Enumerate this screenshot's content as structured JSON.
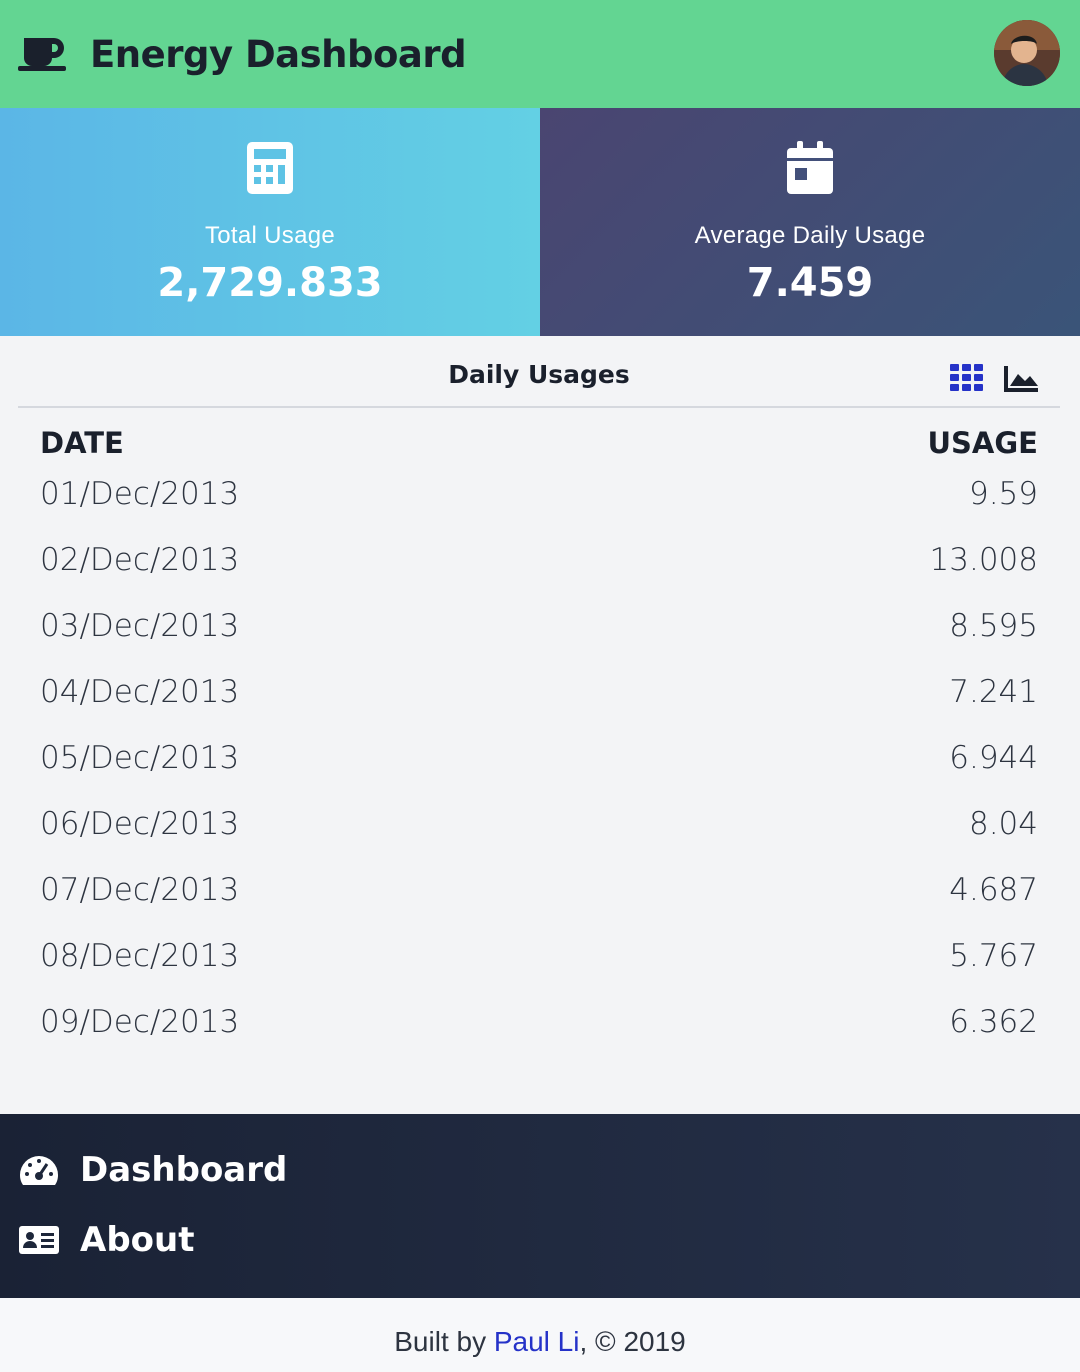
{
  "header": {
    "title": "Energy Dashboard",
    "logo_icon": "mug-icon"
  },
  "stats": {
    "total": {
      "label": "Total Usage",
      "value": "2,729.833",
      "icon": "calculator-icon"
    },
    "average": {
      "label": "Average Daily Usage",
      "value": "7.459",
      "icon": "calendar-icon"
    }
  },
  "panel": {
    "title": "Daily Usages",
    "columns": {
      "date": "DATE",
      "usage": "USAGE"
    },
    "rows": [
      {
        "date": "01/Dec/2013",
        "usage": "9.59"
      },
      {
        "date": "02/Dec/2013",
        "usage": "13.008"
      },
      {
        "date": "03/Dec/2013",
        "usage": "8.595"
      },
      {
        "date": "04/Dec/2013",
        "usage": "7.241"
      },
      {
        "date": "05/Dec/2013",
        "usage": "6.944"
      },
      {
        "date": "06/Dec/2013",
        "usage": "8.04"
      },
      {
        "date": "07/Dec/2013",
        "usage": "4.687"
      },
      {
        "date": "08/Dec/2013",
        "usage": "5.767"
      },
      {
        "date": "09/Dec/2013",
        "usage": "6.362"
      }
    ],
    "view_icons": [
      "grid-view-icon",
      "area-chart-icon"
    ]
  },
  "nav": {
    "items": [
      {
        "label": "Dashboard",
        "icon": "speedometer-icon"
      },
      {
        "label": "About",
        "icon": "id-card-icon"
      }
    ]
  },
  "footer": {
    "prefix": "Built by ",
    "author": "Paul Li",
    "suffix": ", © 2019"
  },
  "colors": {
    "header_bg": "#63d592",
    "accent_blue": "#2532c8",
    "nav_bg": "#1a2235"
  }
}
